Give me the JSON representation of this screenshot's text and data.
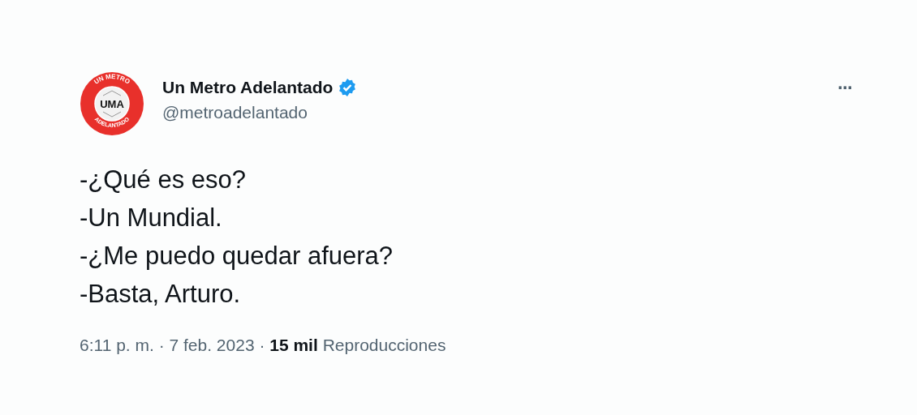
{
  "tweet": {
    "avatar": {
      "ring_top": "UN METRO",
      "ring_bottom": "ADELANTADO",
      "monogram": "UMA"
    },
    "author": {
      "name": "Un Metro Adelantado",
      "verified": true,
      "handle": "@metroadelantado"
    },
    "more_button": "···",
    "lines": [
      "-¿Qué es eso?",
      "-Un Mundial.",
      "-¿Me puedo quedar afuera?",
      "-Basta, Arturo."
    ],
    "meta": "6:11 p. m. · 7 feb. 2023 · **15 mil** Reproducciones"
  }
}
